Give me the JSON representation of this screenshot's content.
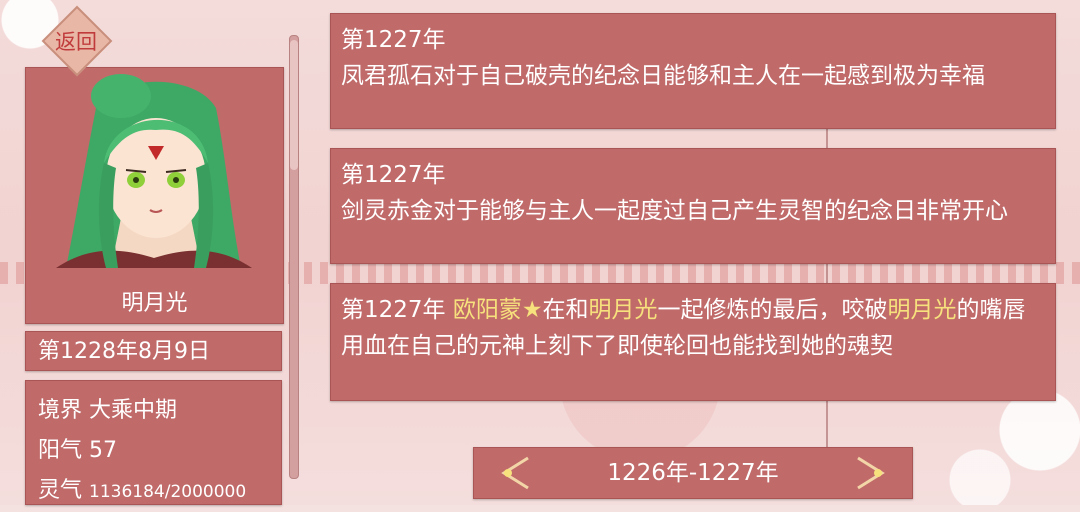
{
  "back_button": {
    "label": "返回"
  },
  "character": {
    "name": "明月光",
    "date": "第1228年8月9日",
    "stats": [
      {
        "label": "境界",
        "value": "大乘中期"
      },
      {
        "label": "阳气",
        "value": "57"
      },
      {
        "label": "灵气",
        "value": "1136184/2000000"
      }
    ]
  },
  "log_entries": [
    {
      "year": "第1227年",
      "text": "凤君孤石对于自己破壳的纪念日能够和主人在一起感到极为幸福"
    },
    {
      "year": "第1227年",
      "text": "剑灵赤金对于能够与主人一起度过自己产生灵智的纪念日非常开心"
    },
    {
      "year": "第1227年",
      "parts": [
        {
          "text": " ",
          "hl": false
        },
        {
          "text": "欧阳蒙★",
          "hl": true
        },
        {
          "text": "在和",
          "hl": false
        },
        {
          "text": "明月光",
          "hl": true
        },
        {
          "text": "一起修炼的最后，咬破",
          "hl": false
        },
        {
          "text": "明月光",
          "hl": true
        },
        {
          "text": "的嘴唇用血在自己的元神上刻下了即使轮回也能找到她的魂契",
          "hl": false
        }
      ]
    }
  ],
  "pager": {
    "range": "1226年-1227年"
  },
  "colors": {
    "panel": "#c06a6a",
    "highlight": "#f6e17c",
    "back_text": "#c03c3c"
  }
}
